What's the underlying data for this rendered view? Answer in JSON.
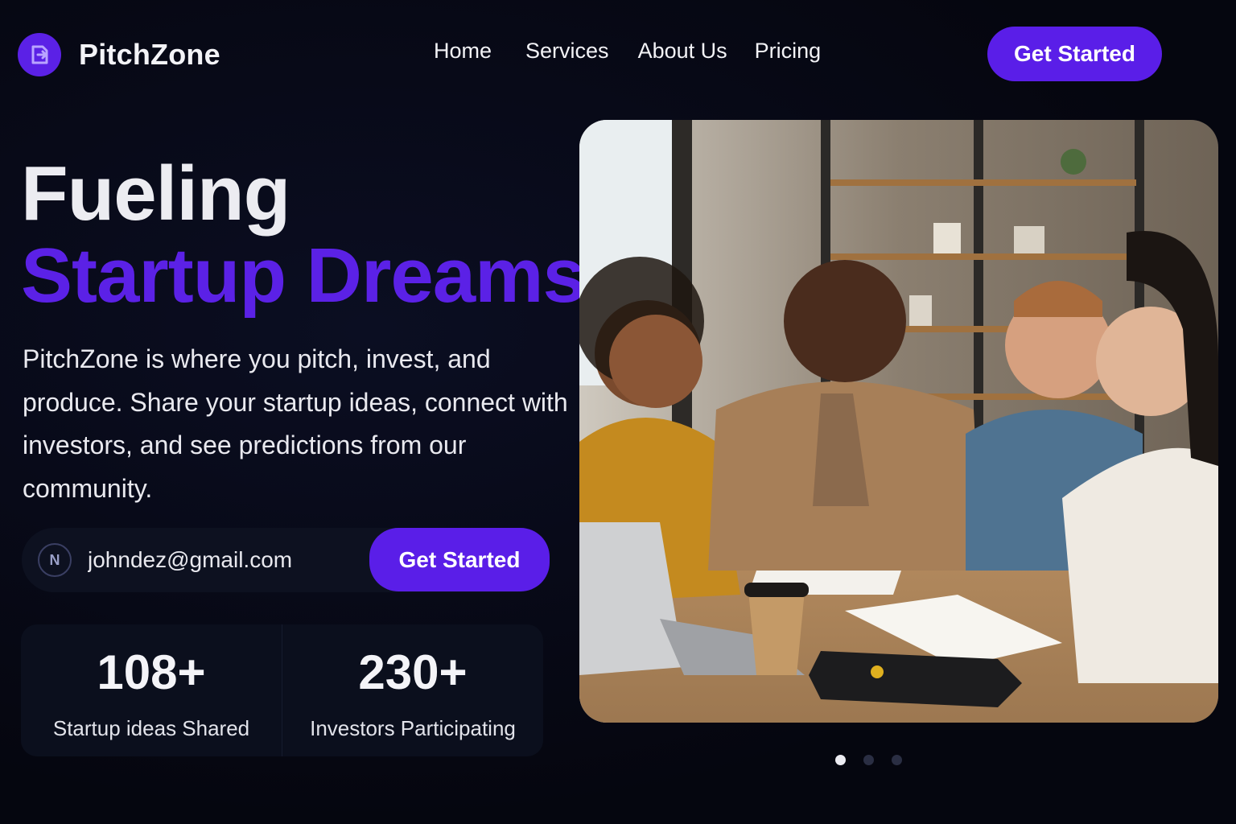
{
  "brand": {
    "name": "PitchZone",
    "accent": "#5b21e6"
  },
  "nav": {
    "items": [
      "Home",
      "Services",
      "About Us",
      "Pricing"
    ],
    "cta_label": "Get Started"
  },
  "hero": {
    "title_line1": "Fueling",
    "title_line2": "Startup Dreams",
    "description": "PitchZone is where you pitch, invest, and produce. Share your startup ideas, connect with investors, and see predictions from our community."
  },
  "signup": {
    "email_value": "johndez@gmail.com",
    "icon_letter": "N",
    "cta_label": "Get Started"
  },
  "stats": [
    {
      "value": "108+",
      "label": "Startup ideas Shared"
    },
    {
      "value": "230+",
      "label": "Investors Participating"
    }
  ],
  "carousel": {
    "slides": 3,
    "active": 0
  },
  "icons": {
    "logo": "logo-icon",
    "email": "email-icon"
  }
}
